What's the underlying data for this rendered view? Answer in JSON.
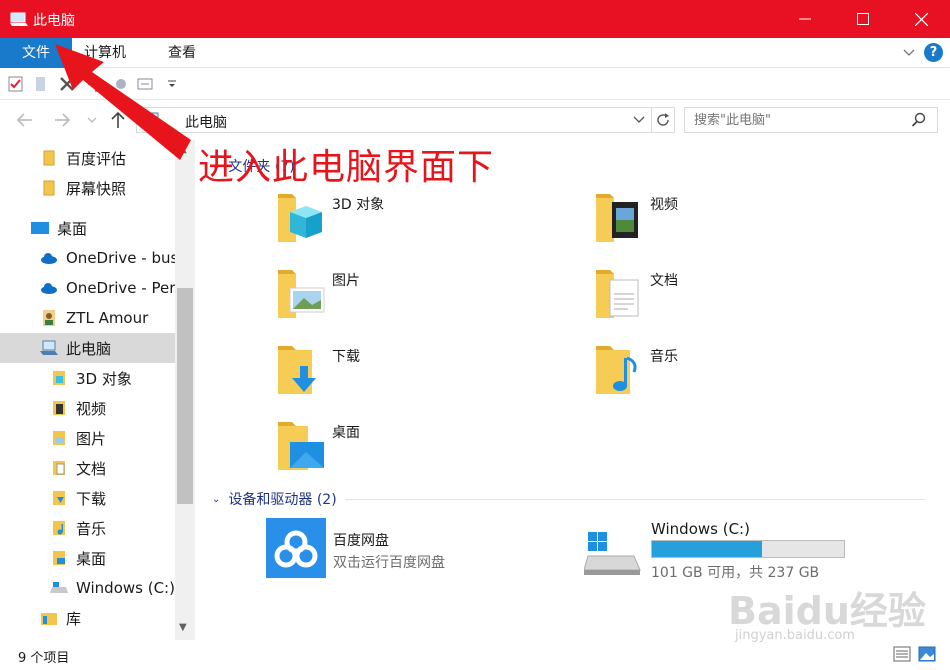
{
  "window": {
    "title": "此电脑"
  },
  "ribbon": {
    "tabs": [
      "文件",
      "计算机",
      "查看"
    ]
  },
  "address": {
    "path": "此电脑"
  },
  "search": {
    "placeholder": "搜索\"此电脑\""
  },
  "sidebar": {
    "items": [
      {
        "label": "百度评估",
        "icon": "folder-icon"
      },
      {
        "label": "屏幕快照",
        "icon": "folder-icon"
      },
      {
        "label": "桌面",
        "icon": "desktop-icon"
      },
      {
        "label": "OneDrive - bus",
        "icon": "cloud-icon"
      },
      {
        "label": "OneDrive - Pers",
        "icon": "cloud-icon"
      },
      {
        "label": "ZTL Amour",
        "icon": "user-icon"
      },
      {
        "label": "此电脑",
        "icon": "computer-icon"
      },
      {
        "label": "3D 对象",
        "icon": "3d-icon"
      },
      {
        "label": "视频",
        "icon": "video-icon"
      },
      {
        "label": "图片",
        "icon": "pictures-icon"
      },
      {
        "label": "文档",
        "icon": "documents-icon"
      },
      {
        "label": "下载",
        "icon": "downloads-icon"
      },
      {
        "label": "音乐",
        "icon": "music-icon"
      },
      {
        "label": "桌面",
        "icon": "desktop-icon"
      },
      {
        "label": "Windows (C:)",
        "icon": "drive-icon"
      },
      {
        "label": "库",
        "icon": "library-icon"
      }
    ]
  },
  "content": {
    "folders_header": "文件夹 (7)",
    "folders": [
      {
        "label": "3D 对象",
        "icon": "3d-icon"
      },
      {
        "label": "视频",
        "icon": "video-icon"
      },
      {
        "label": "图片",
        "icon": "pictures-icon"
      },
      {
        "label": "文档",
        "icon": "documents-icon"
      },
      {
        "label": "下载",
        "icon": "downloads-icon"
      },
      {
        "label": "音乐",
        "icon": "music-icon"
      },
      {
        "label": "桌面",
        "icon": "desktop-icon"
      }
    ],
    "devices_header": "设备和驱动器 (2)",
    "devices": [
      {
        "name": "百度网盘",
        "subtitle": "双击运行百度网盘",
        "icon": "baidu-netdisk-icon"
      },
      {
        "name": "Windows (C:)",
        "subtitle": "101 GB 可用，共 237 GB",
        "icon": "drive-icon",
        "used_fraction": 0.574
      }
    ]
  },
  "status": {
    "count": "9 个项目"
  },
  "annotation": {
    "text": "进入此电脑界面下"
  },
  "watermark": {
    "logo": "Baidu经验",
    "url": "jingyan.baidu.com"
  },
  "colors": {
    "titlebar": "#e81123",
    "accent": "#1979ca",
    "annotation": "#e8141c",
    "drive_bar": "#26a0da"
  }
}
